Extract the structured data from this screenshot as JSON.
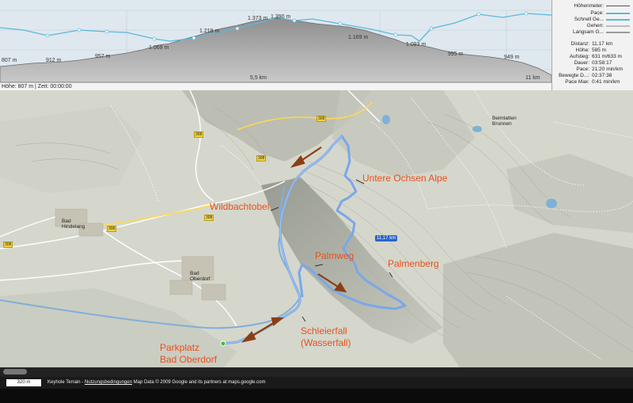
{
  "profile": {
    "elevation_labels": [
      "807 m",
      "912 m",
      "957 m",
      "1.069 m",
      "1.219 m",
      "1.373 m",
      "1.390 m",
      "1.169 m",
      "1.093 m",
      "995 m",
      "949 m"
    ],
    "distance_labels": [
      "5,5 km",
      "11 km"
    ],
    "status_text": "Höhe: 807 m | Zeit: 00:00:00"
  },
  "legend": {
    "items": [
      {
        "label": "Höhenmeter:",
        "color": "#555555"
      },
      {
        "label": "Pace:",
        "color": "#5bb8dc"
      },
      {
        "label": "Schnell Ge...",
        "color": "#5bb8dc"
      },
      {
        "label": "Gehen:",
        "color": "#bcbcbc"
      },
      {
        "label": "Langsam G...",
        "color": "#9a9a9a"
      }
    ]
  },
  "stats": [
    {
      "key": "Distanz:",
      "value": "11,17 km"
    },
    {
      "key": "Höhe:",
      "value": "585 m"
    },
    {
      "key": "Aufstieg:",
      "value": "631 m/633 m"
    },
    {
      "key": "Dauer:",
      "value": "03:58:17"
    },
    {
      "key": "Pace:",
      "value": "21:20 min/km"
    },
    {
      "key": "Bewegte D...:",
      "value": "02:37:38"
    },
    {
      "key": "Pace Max:",
      "value": "0:41 min/km"
    }
  ],
  "map": {
    "annotations": [
      "Untere Ochsen Alpe",
      "Wildbachtobel",
      "Palmweg",
      "Palmenberg",
      "Schleierfall",
      "(Wasserfall)",
      "Parkplatz",
      "Bad Oberdorf"
    ],
    "towns": [
      "Bad",
      "Hindelang",
      "Bad",
      "Oberdorf",
      "Beimlatten",
      "Brunnen"
    ],
    "track_badge": "11,17 km",
    "road_number": "308",
    "route_color": "#7aa7e8",
    "annotation_color": "#e8501c"
  },
  "footer": {
    "scale": "320 m",
    "attribution_prefix": "Keyhole Terrain - ",
    "terms_link": "Nutzungsbedingungen",
    "attribution_suffix": " Map Data © 2009 Google and its partners at maps.google.com"
  }
}
